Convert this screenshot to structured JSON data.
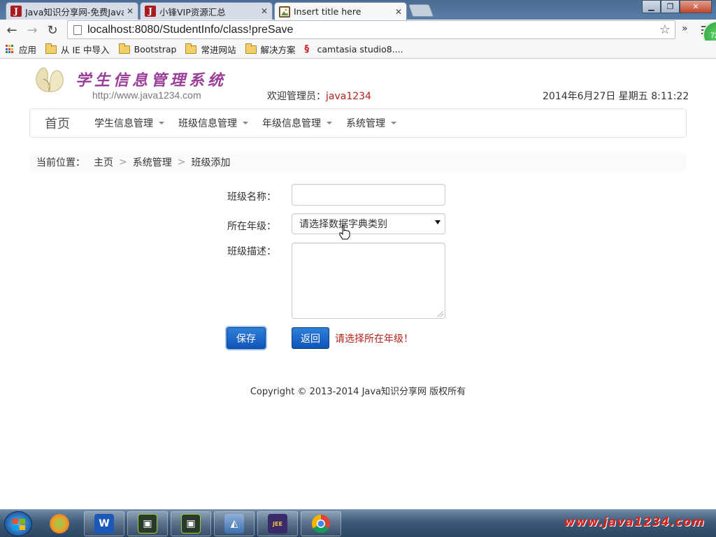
{
  "browser": {
    "tabs": [
      {
        "title": "Java知识分享网-免费Java",
        "icon": "J"
      },
      {
        "title": "小锋VIP资源汇总",
        "icon": "J"
      },
      {
        "title": "Insert title here",
        "icon": "picture"
      }
    ],
    "url": "localhost:8080/StudentInfo/class!preSave",
    "extension_badge": "72",
    "bookmarks": [
      "应用",
      "从 IE 中导入",
      "Bootstrap",
      "常进网站",
      "解决方案",
      "camtasia studio8...."
    ]
  },
  "header": {
    "logo_title": "学生信息管理系统",
    "logo_url": "http://www.java1234.com",
    "welcome_prefix": "欢迎管理员：",
    "username": "java1234",
    "datetime": "2014年6月27日 星期五 8:11:22"
  },
  "navbar": {
    "brand": "首页",
    "menus": [
      "学生信息管理",
      "班级信息管理",
      "年级信息管理",
      "系统管理"
    ]
  },
  "breadcrumb": {
    "prefix": "当前位置：",
    "items": [
      "主页",
      "系统管理",
      "班级添加"
    ],
    "separator": ">"
  },
  "form": {
    "class_name_label": "班级名称：",
    "class_name_value": "",
    "grade_label": "所在年级：",
    "grade_selected": "请选择数据字典类别",
    "desc_label": "班级描述：",
    "desc_value": "",
    "save_label": "保存",
    "back_label": "返回",
    "error_message": "请选择所在年级！"
  },
  "footer": {
    "copyright": "Copyright © 2013-2014 Java知识分享网 版权所有"
  },
  "taskbar": {
    "watermark": "www.java1234.com"
  },
  "colors": {
    "accent_red": "#b3221c",
    "button_blue": "#0f55b8",
    "logo_purple": "#9a3e98"
  }
}
